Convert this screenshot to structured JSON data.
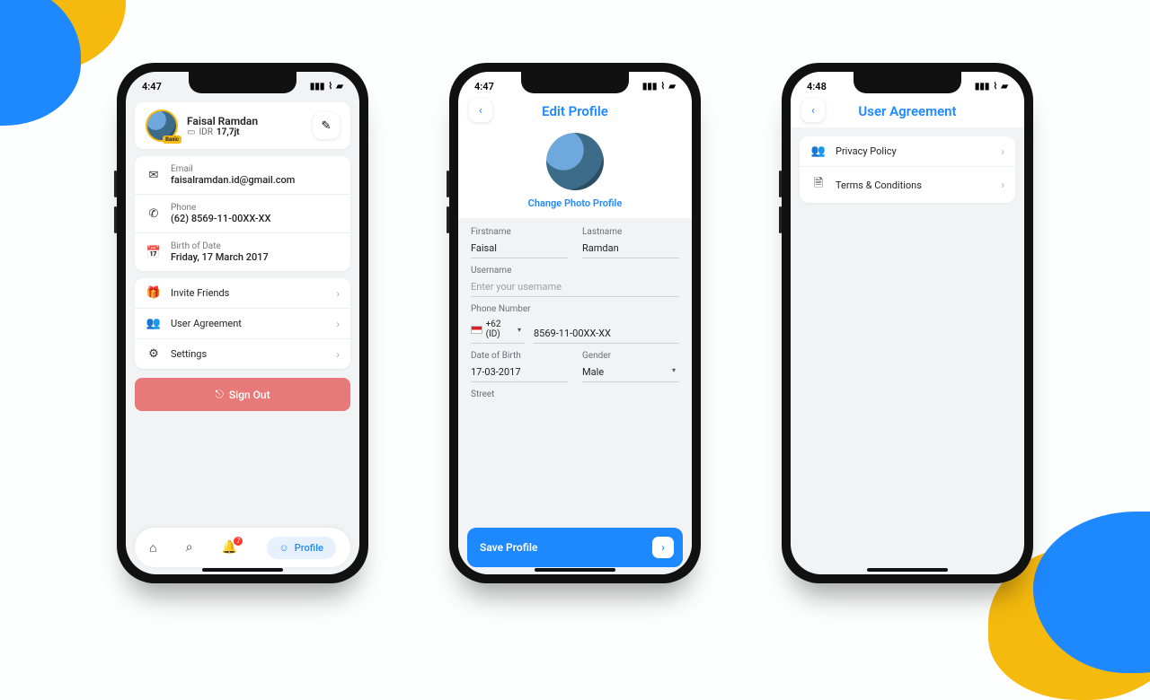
{
  "status": {
    "time1": "4:47",
    "time2": "4:47",
    "time3": "4:48"
  },
  "profile": {
    "name": "Faisal Ramdan",
    "currency": "IDR",
    "balance": "17,7jt",
    "email_label": "Email",
    "email": "faisalramdan.id@gmail.com",
    "phone_label": "Phone",
    "phone": "(62) 8569-11-00XX-XX",
    "dob_label": "Birth of Date",
    "dob": "Friday, 17 March 2017",
    "invite": "Invite Friends",
    "agreement": "User Agreement",
    "settings": "Settings",
    "signout": "Sign Out",
    "tab_profile": "Profile",
    "notif_badge": "7"
  },
  "edit": {
    "title": "Edit Profile",
    "change_photo": "Change Photo Profile",
    "firstname_label": "Firstname",
    "firstname": "Faisal",
    "lastname_label": "Lastname",
    "lastname": "Ramdan",
    "username_label": "Username",
    "username_placeholder": "Enter your username",
    "phone_label": "Phone Number",
    "country": "+62 (ID)",
    "phone": "8569-11-00XX-XX",
    "dob_label": "Date of Birth",
    "dob": "17-03-2017",
    "gender_label": "Gender",
    "gender": "Male",
    "street_label": "Street",
    "save": "Save Profile"
  },
  "agreement": {
    "title": "User Agreement",
    "privacy": "Privacy Policy",
    "terms": "Terms & Conditions"
  }
}
